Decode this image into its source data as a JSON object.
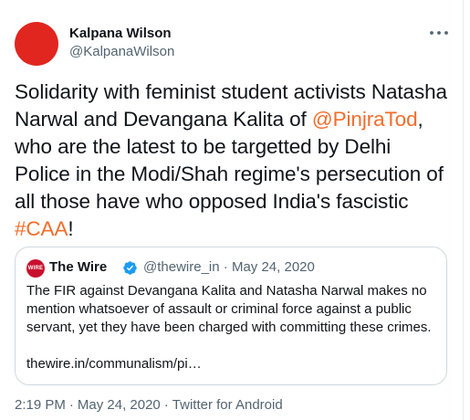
{
  "colors": {
    "avatar": "#e0261f",
    "link": "#f26d2b",
    "secondary_text": "#536471",
    "wire_logo": "#c8102e",
    "verified": "#1d9bf0"
  },
  "author": {
    "name": "Kalpana Wilson",
    "handle": "@KalpanaWilson",
    "more_icon": "more-horizontal-icon"
  },
  "tweet": {
    "text_1": "Solidarity with feminist student activists Natasha Narwal and Devangana Kalita of ",
    "mention": "@PinjraTod",
    "text_2": ", who are the latest to be targetted by Delhi Police in the Modi/Shah regime's persecution of all those have who opposed India's fascistic ",
    "hashtag": "#CAA",
    "text_3": "!"
  },
  "quote": {
    "logo_text": "WIRE",
    "name": "The Wire",
    "verified_icon": "verified-badge-icon",
    "handle": "@thewire_in",
    "dot": "·",
    "date": "May 24, 2020",
    "text": "The FIR against Devangana Kalita and Natasha Narwal makes no mention whatsoever of assault or criminal force against a public servant, yet they have been charged with committing these crimes.",
    "link": "thewire.in/communalism/pi…"
  },
  "footer": {
    "time": "2:19 PM",
    "date": "May 24, 2020",
    "dot": "·",
    "source": "Twitter for Android"
  }
}
